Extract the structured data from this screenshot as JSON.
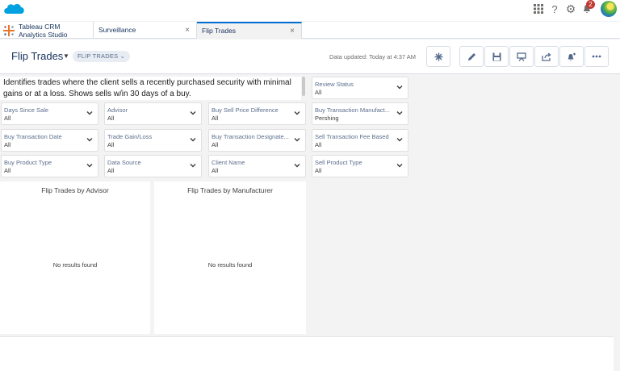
{
  "global": {
    "notification_count": "2"
  },
  "app": {
    "name_line1": "Tableau CRM",
    "name_line2": "Analytics Studio"
  },
  "tabs": [
    {
      "label": "Surveillance",
      "close": "×"
    },
    {
      "label": "Flip Trades",
      "close": "×"
    }
  ],
  "header": {
    "title": "Flip Trades",
    "pill": "FLIP TRADES",
    "updated": "Data updated: Today at 4:37 AM"
  },
  "description": "Identifies trades where the client sells a recently purchased security with minimal gains or at a loss.  Shows sells w/in 30 days of a buy.",
  "filters": [
    {
      "label": "Review Status",
      "value": "All"
    },
    {
      "label": "Days Since Sale",
      "value": "All"
    },
    {
      "label": "Advisor",
      "value": "All"
    },
    {
      "label": "Buy Sell Price Difference",
      "value": "All"
    },
    {
      "label": "Buy Transaction Manufact...",
      "value": "Pershing"
    },
    {
      "label": "Buy Transaction Date",
      "value": "All"
    },
    {
      "label": "Trade Gain/Loss",
      "value": "All"
    },
    {
      "label": "Buy Transaction Designate...",
      "value": "All"
    },
    {
      "label": "Sell Transaction Fee Based",
      "value": "All"
    },
    {
      "label": "Buy Product Type",
      "value": "All"
    },
    {
      "label": "Data Source",
      "value": "All"
    },
    {
      "label": "Client Name",
      "value": "All"
    },
    {
      "label": "Sell Product Type",
      "value": "All"
    }
  ],
  "panels": [
    {
      "title": "Flip Trades by Advisor",
      "empty": "No results found"
    },
    {
      "title": "Flip Trades by Manufacturer",
      "empty": "No results found"
    }
  ],
  "colors": {
    "brand": "#0070d2",
    "badge": "#c23934"
  }
}
